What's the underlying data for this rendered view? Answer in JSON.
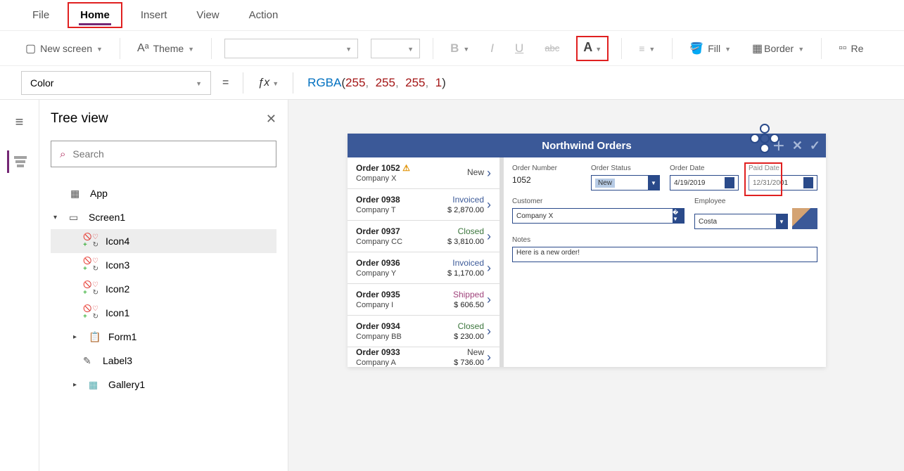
{
  "tabs": {
    "file": "File",
    "home": "Home",
    "insert": "Insert",
    "view": "View",
    "action": "Action"
  },
  "ribbon": {
    "newscreen": "New screen",
    "theme": "Theme",
    "fill": "Fill",
    "border": "Border",
    "reorder": "Re"
  },
  "formula": {
    "property": "Color",
    "fn": "RGBA",
    "args": [
      "255",
      "255",
      "255",
      "1"
    ]
  },
  "tree": {
    "title": "Tree view",
    "search_ph": "Search",
    "items": {
      "app": "App",
      "screen": "Screen1",
      "icon4": "Icon4",
      "icon3": "Icon3",
      "icon2": "Icon2",
      "icon1": "Icon1",
      "form1": "Form1",
      "label3": "Label3",
      "gallery1": "Gallery1"
    }
  },
  "app": {
    "title": "Northwind Orders",
    "orders": [
      {
        "id": "Order 1052",
        "company": "Company X",
        "status": "New",
        "amount": "",
        "warn": true
      },
      {
        "id": "Order 0938",
        "company": "Company T",
        "status": "Invoiced",
        "amount": "$ 2,870.00"
      },
      {
        "id": "Order 0937",
        "company": "Company CC",
        "status": "Closed",
        "amount": "$ 3,810.00"
      },
      {
        "id": "Order 0936",
        "company": "Company Y",
        "status": "Invoiced",
        "amount": "$ 1,170.00"
      },
      {
        "id": "Order 0935",
        "company": "Company I",
        "status": "Shipped",
        "amount": "$ 606.50"
      },
      {
        "id": "Order 0934",
        "company": "Company BB",
        "status": "Closed",
        "amount": "$ 230.00"
      },
      {
        "id": "Order 0933",
        "company": "Company A",
        "status": "New",
        "amount": "$ 736.00"
      }
    ],
    "detail": {
      "labels": {
        "ordernum": "Order Number",
        "orderstatus": "Order Status",
        "orderdate": "Order Date",
        "paiddate": "Paid Date",
        "customer": "Customer",
        "employee": "Employee",
        "notes": "Notes"
      },
      "ordernum": "1052",
      "orderstatus": "New",
      "orderdate": "4/19/2019",
      "paiddate": "12/31/2001",
      "customer": "Company X",
      "employee": "Costa",
      "notes": "Here is a new order!"
    }
  }
}
